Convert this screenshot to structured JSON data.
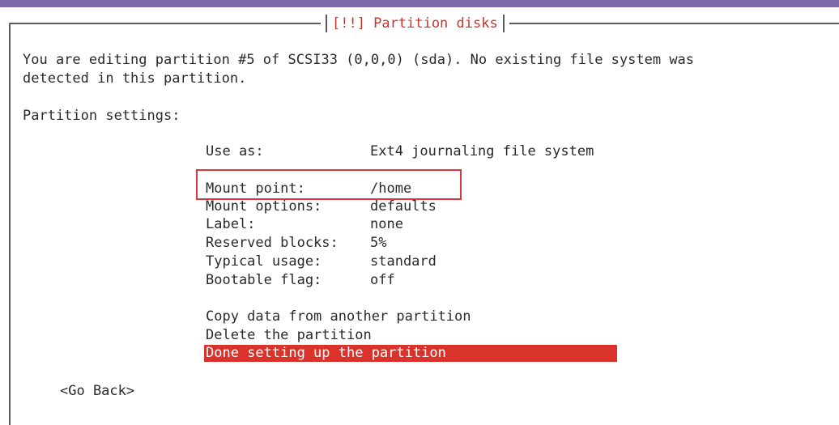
{
  "dialog": {
    "title": "[!!] Partition disks"
  },
  "intro": {
    "line1": "You are editing partition #5 of SCSI33 (0,0,0) (sda). No existing file system was",
    "line2": "detected in this partition."
  },
  "settings_heading": "Partition settings:",
  "settings": [
    {
      "key": "Use as:",
      "value": "Ext4 journaling file system"
    },
    {
      "key": "Mount point:",
      "value": "/home"
    },
    {
      "key": "Mount options:",
      "value": "defaults"
    },
    {
      "key": "Label:",
      "value": "none"
    },
    {
      "key": "Reserved blocks:",
      "value": "5%"
    },
    {
      "key": "Typical usage:",
      "value": "standard"
    },
    {
      "key": "Bootable flag:",
      "value": "off"
    }
  ],
  "actions": [
    "Copy data from another partition",
    "Delete the partition",
    "Done setting up the partition"
  ],
  "go_back": "<Go Back>",
  "colors": {
    "accent_red": "#d9332b",
    "title_red": "#c9342a",
    "top_band": "#7d6aa8"
  }
}
